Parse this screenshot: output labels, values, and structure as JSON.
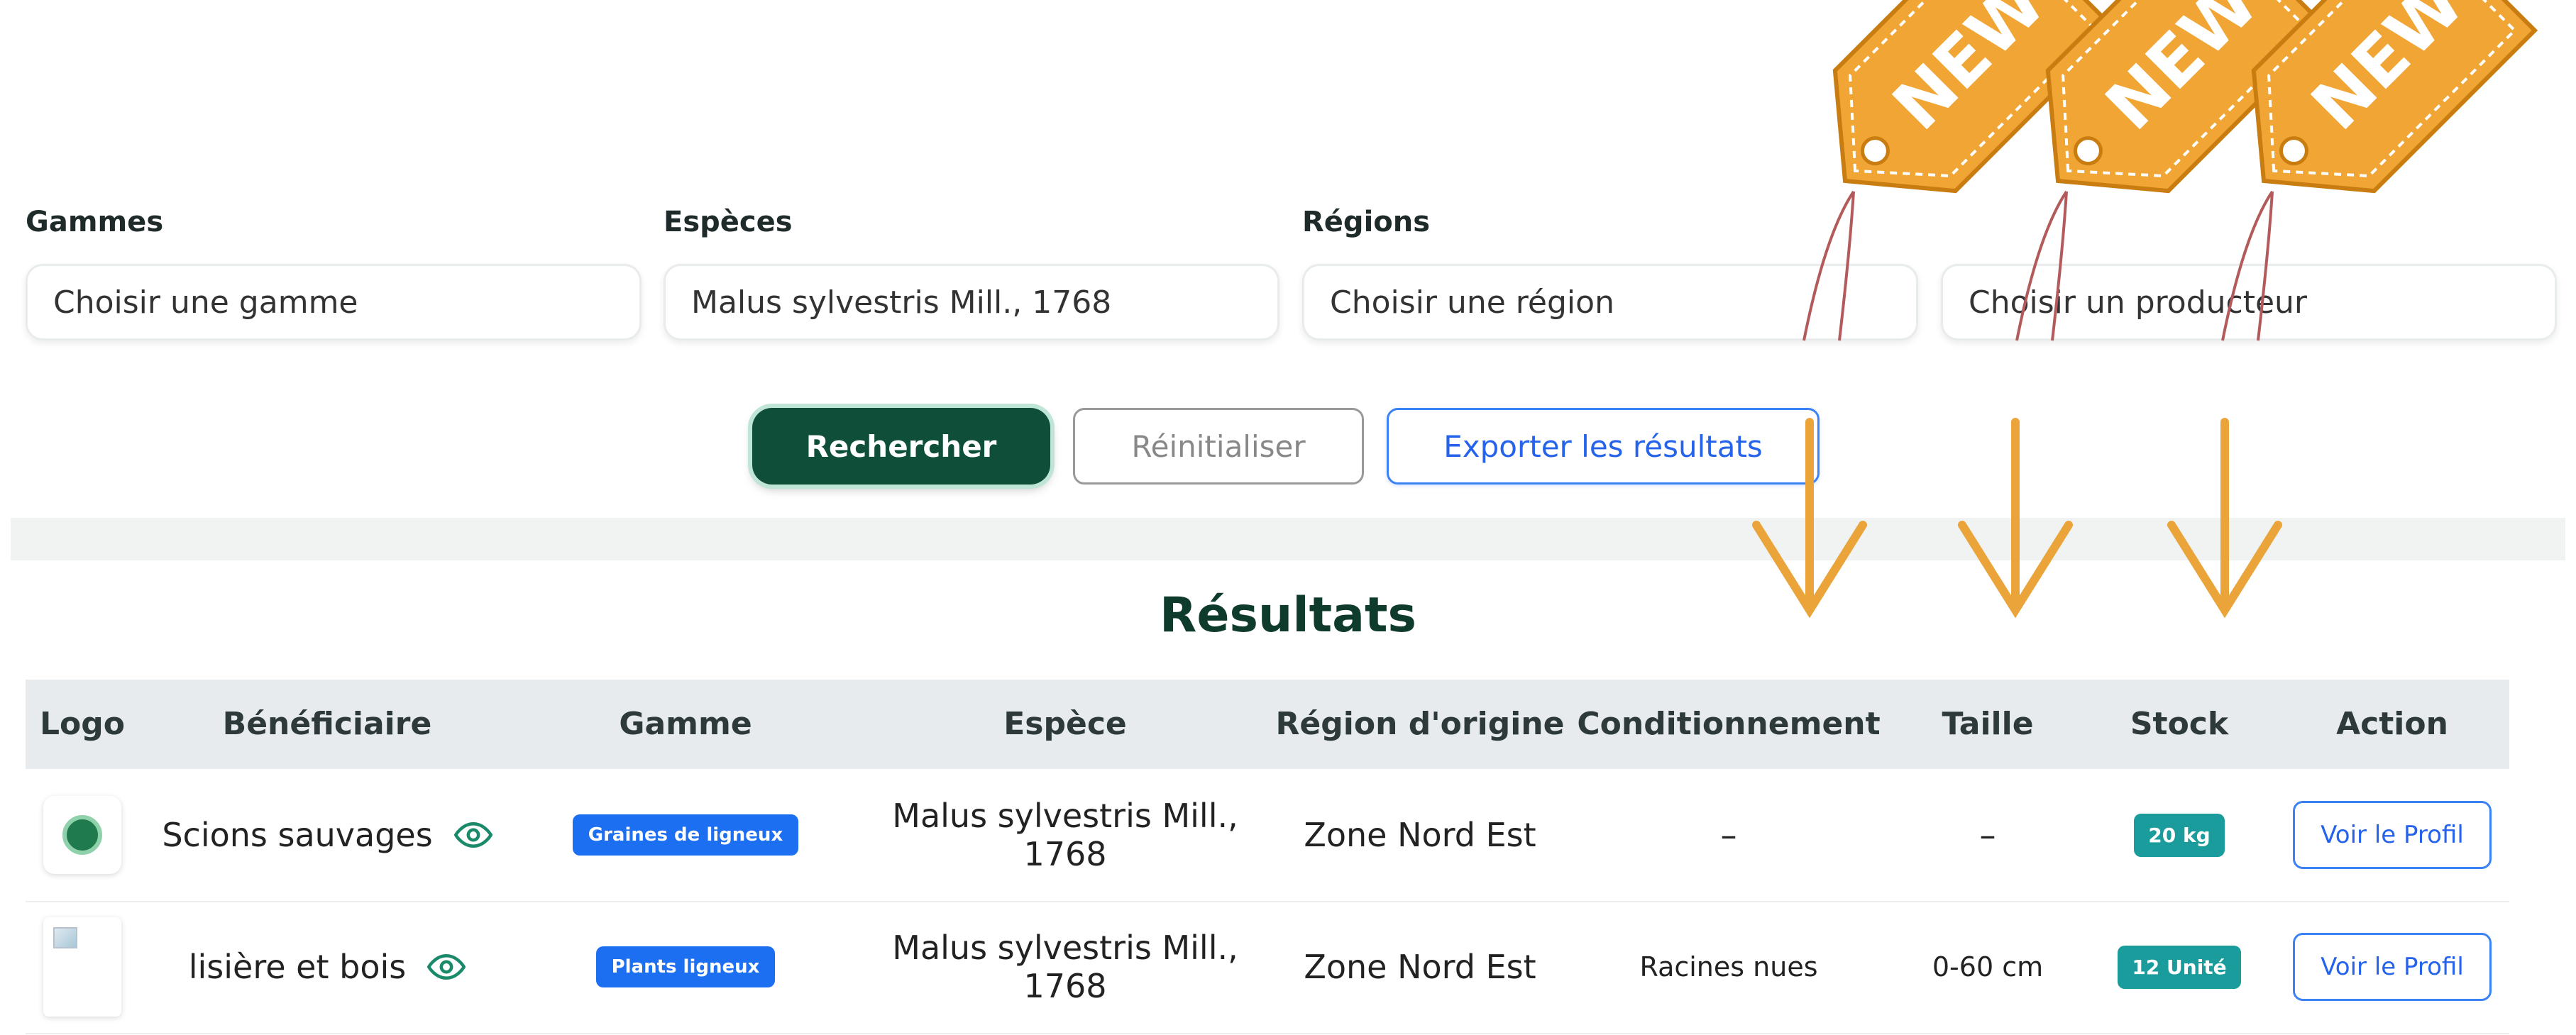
{
  "filters": {
    "gammes_label": "Gammes",
    "gammes_value": "Choisir une gamme",
    "especes_label": "Espèces",
    "especes_value": "Malus sylvestris Mill., 1768",
    "regions_label": "Régions",
    "regions_value": "Choisir une région",
    "producteur_value": "Choisir un producteur"
  },
  "actions": {
    "search": "Rechercher",
    "reset": "Réinitialiser",
    "export": "Exporter les résultats"
  },
  "results": {
    "title": "Résultats",
    "columns": [
      "Logo",
      "Bénéficiaire",
      "Gamme",
      "Espèce",
      "Région d'origine",
      "Conditionnement",
      "Taille",
      "Stock",
      "Action"
    ],
    "rows": [
      {
        "beneficiaire": "Scions sauvages",
        "gamme": "Graines de ligneux",
        "espece": "Malus sylvestris Mill., 1768",
        "region": "Zone Nord Est",
        "conditionnement": "–",
        "taille": "–",
        "stock": "20 kg",
        "action": "Voir le Profil"
      },
      {
        "beneficiaire": "lisière et bois",
        "gamme": "Plants ligneux",
        "espece": "Malus sylvestris Mill., 1768",
        "region": "Zone Nord Est",
        "conditionnement": "Racines nues",
        "taille": "0-60 cm",
        "stock": "12 Unité",
        "action": "Voir le Profil"
      }
    ]
  },
  "new_tags": [
    "NEW",
    "NEW",
    "NEW"
  ],
  "colors": {
    "primary": "#0f4f3a",
    "accent_blue": "#1d6ff2",
    "stock_teal": "#1a9c9c",
    "tag_orange": "#f0a535"
  }
}
